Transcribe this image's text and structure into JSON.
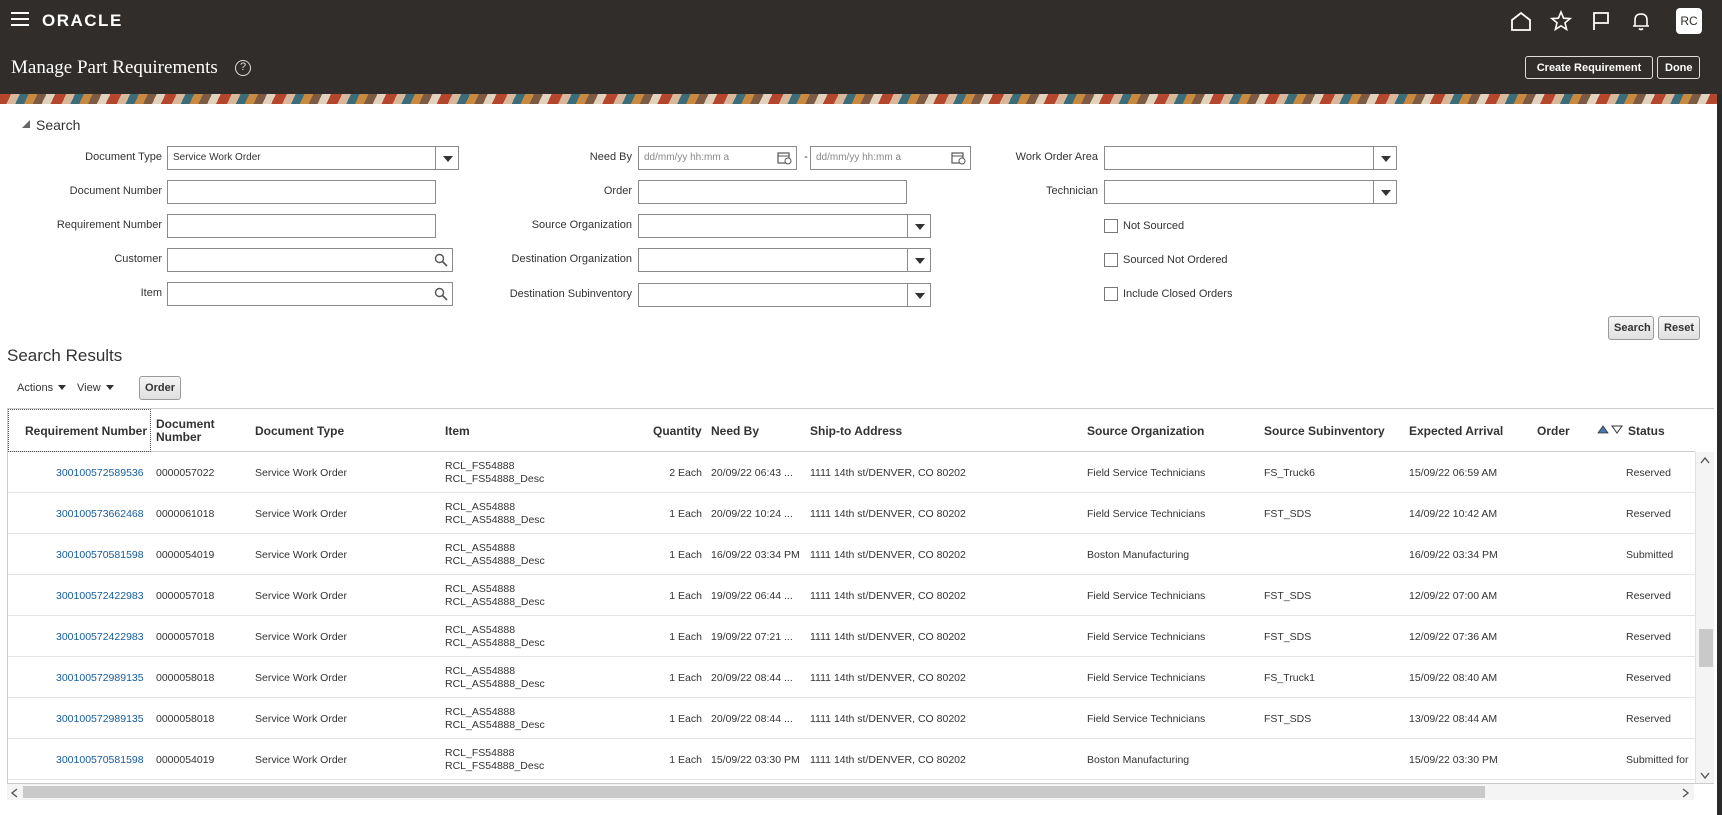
{
  "header": {
    "logo": "ORACLE",
    "page_title": "Manage Part Requirements",
    "help": "?",
    "avatar": "RC",
    "create_requirement": "Create Requirement",
    "done": "Done"
  },
  "search": {
    "title": "Search",
    "labels": {
      "document_type": "Document Type",
      "document_number": "Document Number",
      "requirement_number": "Requirement Number",
      "customer": "Customer",
      "item": "Item",
      "need_by": "Need By",
      "order": "Order",
      "source_organization": "Source Organization",
      "destination_organization": "Destination Organization",
      "destination_subinventory": "Destination Subinventory",
      "work_order_area": "Work Order Area",
      "technician": "Technician",
      "not_sourced": "Not Sourced",
      "sourced_not_ordered": "Sourced Not Ordered",
      "include_closed_orders": "Include Closed Orders"
    },
    "document_type_value": "Service Work Order",
    "date_placeholder": "dd/mm/yy hh:mm a",
    "date_separator": "-",
    "search_button": "Search",
    "reset_button": "Reset"
  },
  "results": {
    "title": "Search Results",
    "actions_menu": "Actions",
    "view_menu": "View",
    "order_button": "Order",
    "columns": {
      "requirement_number": "Requirement Number",
      "document_number": "Document Number",
      "document_type": "Document Type",
      "item": "Item",
      "quantity": "Quantity",
      "need_by": "Need By",
      "ship_to": "Ship-to Address",
      "source_org": "Source Organization",
      "source_subinv": "Source Subinventory",
      "expected_arrival": "Expected Arrival",
      "order": "Order",
      "status": "Status"
    },
    "rows": [
      {
        "req": "300100572589536",
        "doc": "0000057022",
        "type": "Service Work Order",
        "item": "RCL_FS54888",
        "item_desc": "RCL_FS54888_Desc",
        "qty": "2 Each",
        "need_by": "20/09/22 06:43 ...",
        "ship_to": "1111 14th st/DENVER, CO 80202",
        "src_org": "Field Service Technicians",
        "src_sub": "FS_Truck6",
        "arrival": "15/09/22 06:59 AM",
        "order": "",
        "status": "Reserved"
      },
      {
        "req": "300100573662468",
        "doc": "0000061018",
        "type": "Service Work Order",
        "item": "RCL_AS54888",
        "item_desc": "RCL_AS54888_Desc",
        "qty": "1 Each",
        "need_by": "20/09/22 10:24 ...",
        "ship_to": "1111 14th st/DENVER, CO 80202",
        "src_org": "Field Service Technicians",
        "src_sub": "FST_SDS",
        "arrival": "14/09/22 10:42 AM",
        "order": "",
        "status": "Reserved"
      },
      {
        "req": "300100570581598",
        "doc": "0000054019",
        "type": "Service Work Order",
        "item": "RCL_AS54888",
        "item_desc": "RCL_AS54888_Desc",
        "qty": "1 Each",
        "need_by": "16/09/22 03:34 PM",
        "ship_to": "1111 14th st/DENVER, CO 80202",
        "src_org": "Boston Manufacturing",
        "src_sub": "",
        "arrival": "16/09/22 03:34 PM",
        "order": "",
        "status": "Submitted"
      },
      {
        "req": "300100572422983",
        "doc": "0000057018",
        "type": "Service Work Order",
        "item": "RCL_AS54888",
        "item_desc": "RCL_AS54888_Desc",
        "qty": "1 Each",
        "need_by": "19/09/22 06:44 ...",
        "ship_to": "1111 14th st/DENVER, CO 80202",
        "src_org": "Field Service Technicians",
        "src_sub": "FST_SDS",
        "arrival": "12/09/22 07:00 AM",
        "order": "",
        "status": "Reserved"
      },
      {
        "req": "300100572422983",
        "doc": "0000057018",
        "type": "Service Work Order",
        "item": "RCL_AS54888",
        "item_desc": "RCL_AS54888_Desc",
        "qty": "1 Each",
        "need_by": "19/09/22 07:21 ...",
        "ship_to": "1111 14th st/DENVER, CO 80202",
        "src_org": "Field Service Technicians",
        "src_sub": "FST_SDS",
        "arrival": "12/09/22 07:36 AM",
        "order": "",
        "status": "Reserved"
      },
      {
        "req": "300100572989135",
        "doc": "0000058018",
        "type": "Service Work Order",
        "item": "RCL_AS54888",
        "item_desc": "RCL_AS54888_Desc",
        "qty": "1 Each",
        "need_by": "20/09/22 08:44 ...",
        "ship_to": "1111 14th st/DENVER, CO 80202",
        "src_org": "Field Service Technicians",
        "src_sub": "FS_Truck1",
        "arrival": "15/09/22 08:40 AM",
        "order": "",
        "status": "Reserved"
      },
      {
        "req": "300100572989135",
        "doc": "0000058018",
        "type": "Service Work Order",
        "item": "RCL_AS54888",
        "item_desc": "RCL_AS54888_Desc",
        "qty": "1 Each",
        "need_by": "20/09/22 08:44 ...",
        "ship_to": "1111 14th st/DENVER, CO 80202",
        "src_org": "Field Service Technicians",
        "src_sub": "FST_SDS",
        "arrival": "13/09/22 08:44 AM",
        "order": "",
        "status": "Reserved"
      },
      {
        "req": "300100570581598",
        "doc": "0000054019",
        "type": "Service Work Order",
        "item": "RCL_FS54888",
        "item_desc": "RCL_FS54888_Desc",
        "qty": "1 Each",
        "need_by": "15/09/22 03:30 PM",
        "ship_to": "1111 14th st/DENVER, CO 80202",
        "src_org": "Boston Manufacturing",
        "src_sub": "",
        "arrival": "15/09/22 03:30 PM",
        "order": "",
        "status": "Submitted for"
      }
    ]
  },
  "colors": {
    "header_bg": "#312d2a",
    "link": "#145c9e"
  }
}
